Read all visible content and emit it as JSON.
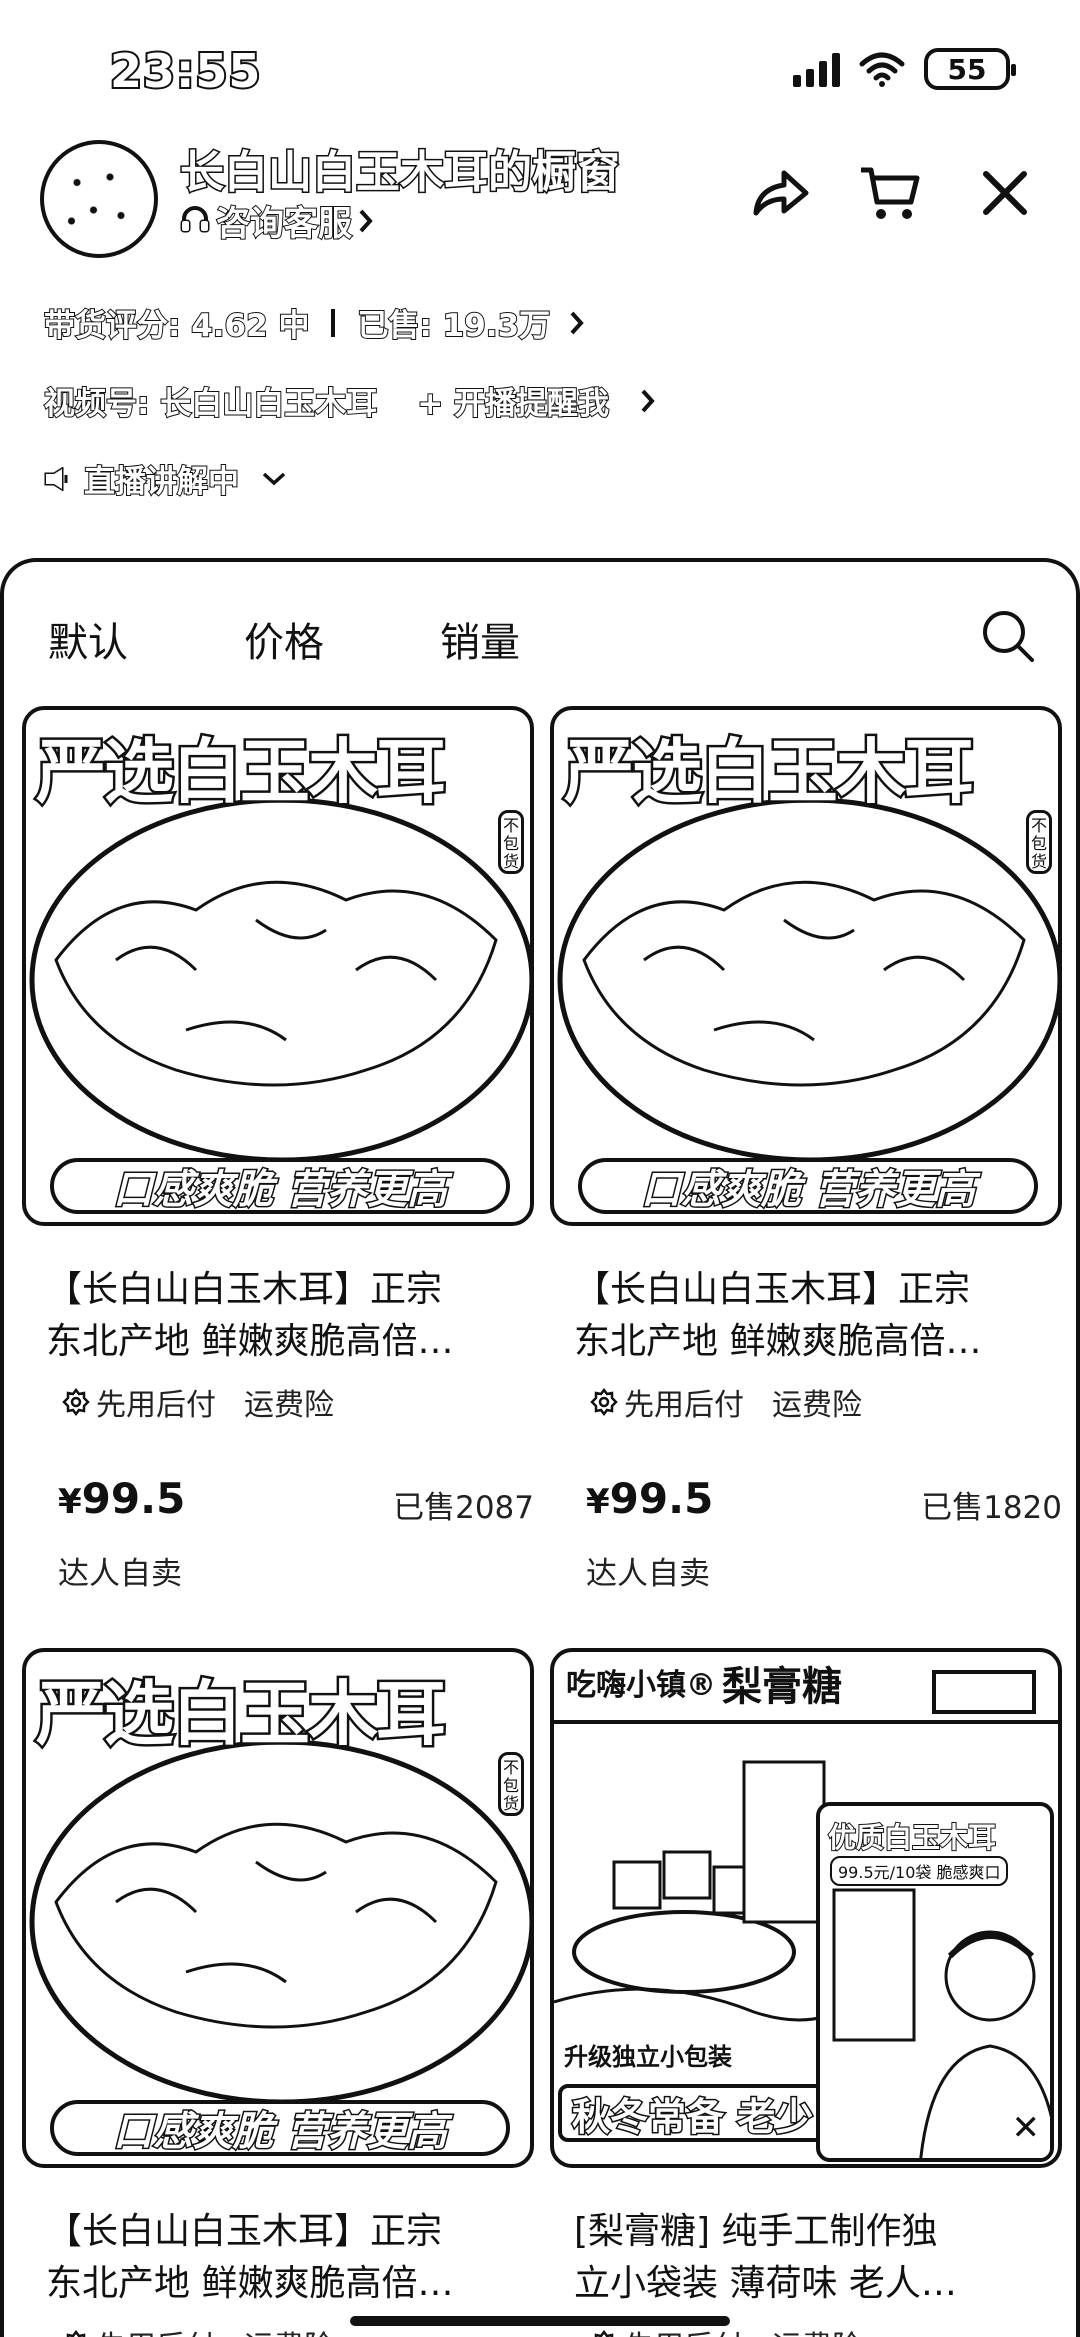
{
  "status_bar": {
    "time": "23:55",
    "battery": "55"
  },
  "header": {
    "title": "长白山白玉木耳的橱窗",
    "service_link": "咨询客服",
    "icons": [
      "share-icon",
      "cart-icon",
      "close-icon"
    ]
  },
  "info": {
    "rating_label": "带货评分: 4.62 中",
    "sold_label": "已售: 19.3万",
    "video_account": "视频号: 长白山白玉木耳",
    "live_reminder": "+ 开播提醒我",
    "live_status": "直播讲解中"
  },
  "tabs": [
    {
      "label": "默认"
    },
    {
      "label": "价格"
    },
    {
      "label": "销量"
    }
  ],
  "products": [
    {
      "image_top": "严选白玉木耳",
      "image_bottom": "口感爽脆 营养更高",
      "image_side": "不包货",
      "name_line1": "【长白山白玉木耳】正宗",
      "name_line2": "东北产地 鲜嫩爽脆高倍…",
      "tag1": "先用后付",
      "tag2": "运费险",
      "price_symbol": "¥",
      "price": "99.5",
      "sold": "已售2087",
      "seller": "达人自卖"
    },
    {
      "image_top": "严选白玉木耳",
      "image_bottom": "口感爽脆 营养更高",
      "image_side": "不包货",
      "name_line1": "【长白山白玉木耳】正宗",
      "name_line2": "东北产地 鲜嫩爽脆高倍…",
      "tag1": "先用后付",
      "tag2": "运费险",
      "price_symbol": "¥",
      "price": "99.5",
      "sold": "已售1820",
      "seller": "达人自卖"
    },
    {
      "image_top": "严选白玉木耳",
      "image_bottom": "口感爽脆 营养更高",
      "image_side": "不包货",
      "name_line1": "【长白山白玉木耳】正宗",
      "name_line2": "东北产地 鲜嫩爽脆高倍…",
      "tag1": "先用后付",
      "tag2": "运费险"
    },
    {
      "image_brand": "吃嗨小镇®",
      "image_product": "梨膏糖",
      "image_sub": "升级独立小包装",
      "image_slogan": "秋冬常备 老少",
      "live_title": "优质白玉木耳",
      "live_sub": "99.5元/10袋 脆感爽口",
      "name_line1": "[梨膏糖] 纯手工制作独",
      "name_line2": "立小袋装 薄荷味 老人…",
      "tag1": "先用后付",
      "tag2": "运费险"
    }
  ]
}
